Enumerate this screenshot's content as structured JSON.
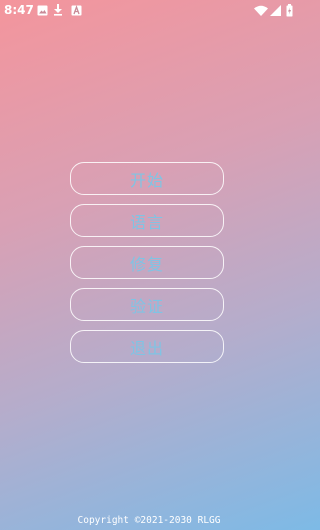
{
  "status_bar": {
    "time": "8:47",
    "left_icons": [
      "image-icon",
      "download-icon",
      "text-a-icon"
    ],
    "right_icons": [
      "wifi-icon",
      "signal-icon",
      "battery-icon"
    ]
  },
  "menu": {
    "items": [
      {
        "label": "开始"
      },
      {
        "label": "语言"
      },
      {
        "label": "修复"
      },
      {
        "label": "验证"
      },
      {
        "label": "退出"
      }
    ]
  },
  "footer": {
    "copyright": "Copyright ©2021-2030 RLGG"
  },
  "colors": {
    "gradient_start": "#f4959c",
    "gradient_end": "#7dbae6",
    "button_text": "#7fc4e4",
    "button_border": "#ffffff"
  }
}
